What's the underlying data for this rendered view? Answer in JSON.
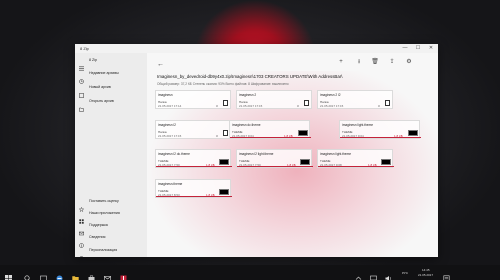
{
  "window": {
    "title": "8 Zip",
    "minimize": "—",
    "maximize": "☐",
    "close": "✕"
  },
  "sidebar": {
    "app_name": "8 Zip",
    "items": [
      {
        "label": "8 Zip"
      },
      {
        "label": "Недавние архивы"
      },
      {
        "label": "Новый архив"
      },
      {
        "label": "Открыть архив"
      }
    ],
    "bottom_items": [
      {
        "label": "Поставить оценку"
      },
      {
        "label": "Наши приложения"
      },
      {
        "label": "Поддержка"
      },
      {
        "label": "Сведения"
      },
      {
        "label": "Персонализация"
      }
    ]
  },
  "toolbar": {
    "back": "←",
    "add": "+",
    "extract": "⭳",
    "delete": "🗑",
    "share": "⇪",
    "settings": "⚙"
  },
  "main": {
    "path": "Imaginesn_by_devedroid-db9y4x0.zip\\Imaginesn\\1703 CREATORS UPDATE\\With AddressBar\\",
    "info": "Общий размер: 37,2 КБ     Степень сжатия: 93%     Всего файлов: 8     Шифрование: выключено"
  },
  "cards": [
    {
      "name": "imaginesn",
      "type": "Папка",
      "date": "21.05.2017 17:14",
      "count": "3",
      "kind": "folder"
    },
    {
      "name": "imaginesn 2",
      "type": "Папка",
      "date": "21.05.2017 17:15",
      "count": "3",
      "kind": "folder"
    },
    {
      "name": "imaginesn 2 l2",
      "type": "Папка",
      "date": "21.05.2017 17:15",
      "count": "3",
      "kind": "folder"
    },
    {
      "name": "imaginesn l2",
      "type": "Папка",
      "date": "21.05.2017 17:15",
      "count": "3",
      "kind": "folder"
    },
    {
      "name": "imaginesn dc.theme",
      "type": "THEME",
      "date": "21.05.2017 9:04",
      "size": "1,8 КБ",
      "kind": "theme"
    },
    {
      "name": "imaginesn light.theme",
      "type": "THEME",
      "date": "21.05.2017 9:04",
      "size": "1,8 КБ",
      "kind": "theme"
    },
    {
      "name": "imaginesn l2 dc.theme",
      "type": "THEME",
      "date": "21.05.2017 7:50",
      "size": "1,8 КБ",
      "kind": "theme"
    },
    {
      "name": "imaginesn l2 light.theme",
      "type": "THEME",
      "date": "21.05.2017 7:50",
      "size": "1,8 КБ",
      "kind": "theme"
    },
    {
      "name": "imaginesn light.theme",
      "type": "THEME",
      "date": "21.05.2017 9:08",
      "size": "1,8 КБ",
      "kind": "theme"
    },
    {
      "name": "imaginesn.theme",
      "type": "THEME",
      "date": "21.05.2017 8:53",
      "size": "1,8 КБ",
      "kind": "theme"
    }
  ],
  "taskbar": {
    "lang": "РУС",
    "time": "14:45",
    "date": "21.05.2017"
  },
  "colors": {
    "accent": "#c4223a",
    "taskbar": "#111113",
    "sidebar": "#ececec"
  }
}
